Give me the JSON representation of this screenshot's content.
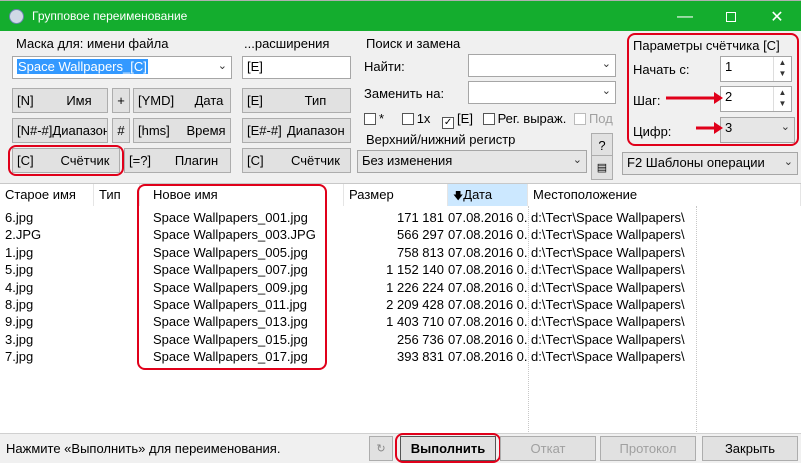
{
  "window": {
    "title": "Групповое переименование"
  },
  "mask": {
    "label": "Маска для: имени файла",
    "name_value": "Space Wallpapers_[C]",
    "ext_label": "...расширения",
    "ext_value": "[E]",
    "buttons": [
      {
        "code": "[N]",
        "label": "Имя"
      },
      {
        "code": "+",
        "label": ""
      },
      {
        "code": "[YMD]",
        "label": "Дата"
      },
      {
        "code": "[N#-#]",
        "label": "Диапазон"
      },
      {
        "code": "#",
        "label": ""
      },
      {
        "code": "[hms]",
        "label": "Время"
      },
      {
        "code": "[C]",
        "label": "Счётчик"
      },
      {
        "code": "[=?]",
        "label": "Плагин"
      }
    ],
    "ext_buttons": [
      {
        "code": "[E]",
        "label": "Тип"
      },
      {
        "code": "[E#-#]",
        "label": "Диапазон"
      },
      {
        "code": "[C]",
        "label": "Счётчик"
      }
    ]
  },
  "search": {
    "label": "Поиск и замена",
    "find_label": "Найти:",
    "find_value": "",
    "replace_label": "Заменить на:",
    "replace_value": "",
    "opt_star": "*",
    "opt_1x": "1x",
    "opt_e": "[E]",
    "opt_regex": "Рег. выраж.",
    "opt_sub": "Под",
    "case_label": "Верхний/нижний регистр",
    "case_value": "Без изменения",
    "help": "?"
  },
  "counter": {
    "label": "Параметры счётчика [C]",
    "start_label": "Начать с:",
    "start_value": "1",
    "step_label": "Шаг:",
    "step_value": "2",
    "digits_label": "Цифр:",
    "digits_value": "3",
    "templates": "F2 Шаблоны операции"
  },
  "table": {
    "headers": [
      "Старое имя",
      "Тип",
      "Новое имя",
      "Размер",
      "Дата",
      "Местоположение"
    ],
    "rows": [
      [
        "6.jpg",
        "",
        "Space Wallpapers_001.jpg",
        "171 181",
        "07.08.2016 0...",
        "d:\\Тест\\Space Wallpapers\\"
      ],
      [
        "2.JPG",
        "",
        "Space Wallpapers_003.JPG",
        "566 297",
        "07.08.2016 0...",
        "d:\\Тест\\Space Wallpapers\\"
      ],
      [
        "1.jpg",
        "",
        "Space Wallpapers_005.jpg",
        "758 813",
        "07.08.2016 0...",
        "d:\\Тест\\Space Wallpapers\\"
      ],
      [
        "5.jpg",
        "",
        "Space Wallpapers_007.jpg",
        "1 152 140",
        "07.08.2016 0...",
        "d:\\Тест\\Space Wallpapers\\"
      ],
      [
        "4.jpg",
        "",
        "Space Wallpapers_009.jpg",
        "1 226 224",
        "07.08.2016 0...",
        "d:\\Тест\\Space Wallpapers\\"
      ],
      [
        "8.jpg",
        "",
        "Space Wallpapers_011.jpg",
        "2 209 428",
        "07.08.2016 0...",
        "d:\\Тест\\Space Wallpapers\\"
      ],
      [
        "9.jpg",
        "",
        "Space Wallpapers_013.jpg",
        "1 403 710",
        "07.08.2016 0...",
        "d:\\Тест\\Space Wallpapers\\"
      ],
      [
        "3.jpg",
        "",
        "Space Wallpapers_015.jpg",
        "256 736",
        "07.08.2016 0...",
        "d:\\Тест\\Space Wallpapers\\"
      ],
      [
        "7.jpg",
        "",
        "Space Wallpapers_017.jpg",
        "393 831",
        "07.08.2016 0...",
        "d:\\Тест\\Space Wallpapers\\"
      ]
    ]
  },
  "status": {
    "text": "Нажмите «Выполнить» для переименования.",
    "run": "Выполнить",
    "undo": "Откат",
    "log": "Протокол",
    "close": "Закрыть"
  },
  "colors": {
    "titlebar": "#14ad2e",
    "highlight": "#e0001a",
    "selection": "#3399ff"
  }
}
